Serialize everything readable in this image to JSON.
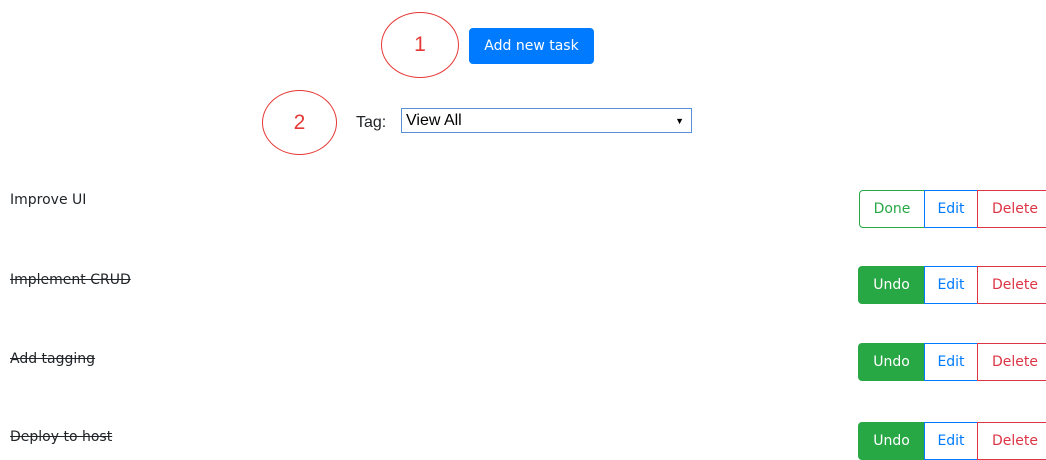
{
  "annotations": {
    "circle_1": "1",
    "circle_2": "2",
    "color": "#e53935"
  },
  "toolbar": {
    "add_task_label": "Add new task"
  },
  "filter": {
    "tag_label": "Tag:",
    "tag_value": "View All"
  },
  "colors": {
    "primary": "#007bff",
    "success": "#28a745",
    "danger": "#dc3545"
  },
  "tasks": [
    {
      "title": "Improve UI",
      "completed": false,
      "status_label": "Done",
      "edit_label": "Edit",
      "delete_label": "Delete"
    },
    {
      "title": "Implement CRUD",
      "completed": true,
      "status_label": "Undo",
      "edit_label": "Edit",
      "delete_label": "Delete"
    },
    {
      "title": "Add tagging",
      "completed": true,
      "status_label": "Undo",
      "edit_label": "Edit",
      "delete_label": "Delete"
    },
    {
      "title": "Deploy to host",
      "completed": true,
      "status_label": "Undo",
      "edit_label": "Edit",
      "delete_label": "Delete"
    }
  ]
}
